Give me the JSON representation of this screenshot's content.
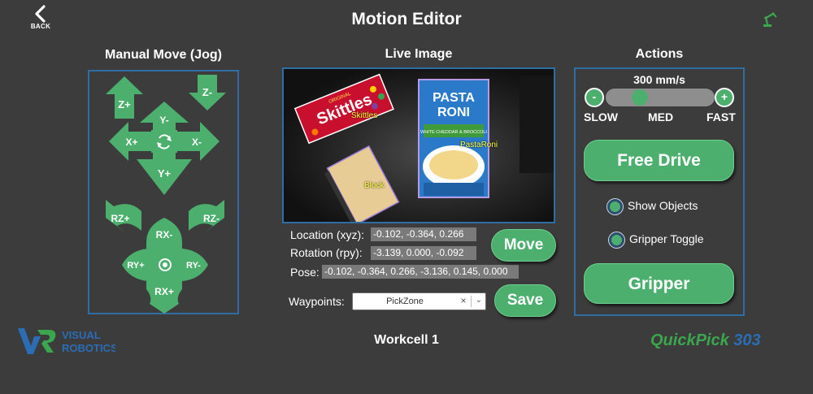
{
  "header": {
    "back_label": "BACK",
    "title": "Motion Editor",
    "robot_icon": "robot-arm-icon"
  },
  "jog": {
    "title": "Manual Move (Jog)",
    "buttons": {
      "z_plus": "Z+",
      "z_minus": "Z-",
      "y_minus": "Y-",
      "x_plus": "X+",
      "x_minus": "X-",
      "y_plus": "Y+",
      "rz_plus": "RZ+",
      "rz_minus": "RZ-",
      "rx_minus": "RX-",
      "ry_plus": "RY+",
      "ry_minus": "RY-",
      "rx_plus": "RX+"
    },
    "center_icons": [
      "rotate-refresh-icon",
      "target-center-icon"
    ]
  },
  "live": {
    "title": "Live Image",
    "objects": [
      {
        "name": "Skittles",
        "label": "Skittles"
      },
      {
        "name": "PastaRoni",
        "label": "PastaRoni"
      },
      {
        "name": "Block",
        "label": "Block"
      }
    ],
    "package_text": {
      "skittles_brand": "Skittles",
      "skittles_small": "ORIGINAL",
      "pasta_line1": "PASTA",
      "pasta_line2": "RONI",
      "pasta_flavor": "WHITE CHEDDAR & BROCCOLI"
    }
  },
  "pose": {
    "location_label": "Location (xyz):",
    "location_value": "-0.102, -0.364, 0.266",
    "rotation_label": "Rotation (rpy):",
    "rotation_value": "-3.139, 0.000, -0.092",
    "pose_label": "Pose:",
    "pose_value": "-0.102, -0.364, 0.266, -3.136, 0.145, 0.000",
    "move_label": "Move",
    "waypoints_label": "Waypoints:",
    "waypoint_selected": "PickZone",
    "waypoint_clear": "×",
    "waypoint_chevron": "⌄",
    "save_label": "Save"
  },
  "actions": {
    "title": "Actions",
    "speed_value": "300 mm/s",
    "speed_level": 0.3,
    "minus_label": "-",
    "plus_label": "+",
    "slow_label": "SLOW",
    "med_label": "MED",
    "fast_label": "FAST",
    "free_drive_label": "Free Drive",
    "show_objects_label": "Show Objects",
    "gripper_toggle_label": "Gripper Toggle",
    "gripper_label": "Gripper"
  },
  "footer": {
    "workcell": "Workcell 1",
    "brand_line1": "VISUAL",
    "brand_line2": "ROBOTICS",
    "product_part1": "QuickPick",
    "product_part2": " 303"
  },
  "colors": {
    "background": "#3c3c3c",
    "accent_green": "#4caf6e",
    "panel_border": "#2f6ea5",
    "brand_blue": "#2a6db5",
    "brand_green": "#3aa64e"
  }
}
